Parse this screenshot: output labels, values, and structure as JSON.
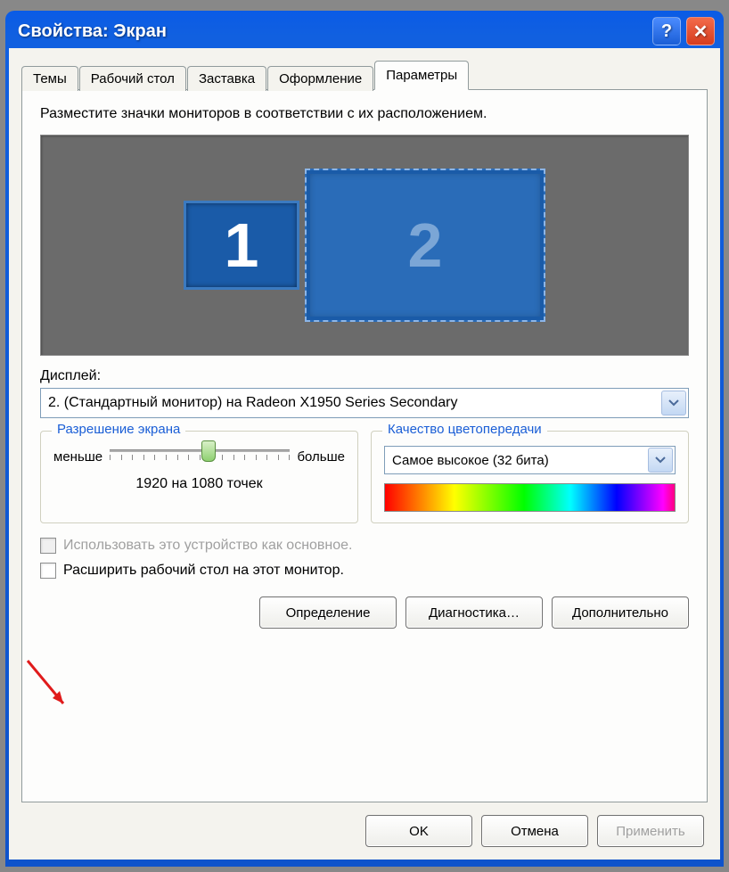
{
  "window": {
    "title": "Свойства: Экран"
  },
  "tabs": {
    "items": [
      {
        "label": "Темы"
      },
      {
        "label": "Рабочий стол"
      },
      {
        "label": "Заставка"
      },
      {
        "label": "Оформление"
      },
      {
        "label": "Параметры"
      }
    ],
    "active_index": 4
  },
  "panel": {
    "instruction": "Разместите значки мониторов в соответствии с их расположением.",
    "monitors": [
      {
        "number": "1",
        "active": false
      },
      {
        "number": "2",
        "active": true
      }
    ],
    "display_label": "Дисплей:",
    "display_value": "2. (Стандартный монитор) на Radeon X1950 Series Secondary",
    "resolution": {
      "group_title": "Разрешение экрана",
      "less": "меньше",
      "more": "больше",
      "current": "1920 на 1080 точек"
    },
    "color": {
      "group_title": "Качество цветопередачи",
      "value": "Самое высокое (32 бита)"
    },
    "primary_checkbox": "Использовать это устройство как основное.",
    "extend_checkbox": "Расширить рабочий стол на этот монитор.",
    "buttons": {
      "identify": "Определение",
      "troubleshoot": "Диагностика…",
      "advanced": "Дополнительно"
    }
  },
  "footer": {
    "ok": "OK",
    "cancel": "Отмена",
    "apply": "Применить"
  }
}
